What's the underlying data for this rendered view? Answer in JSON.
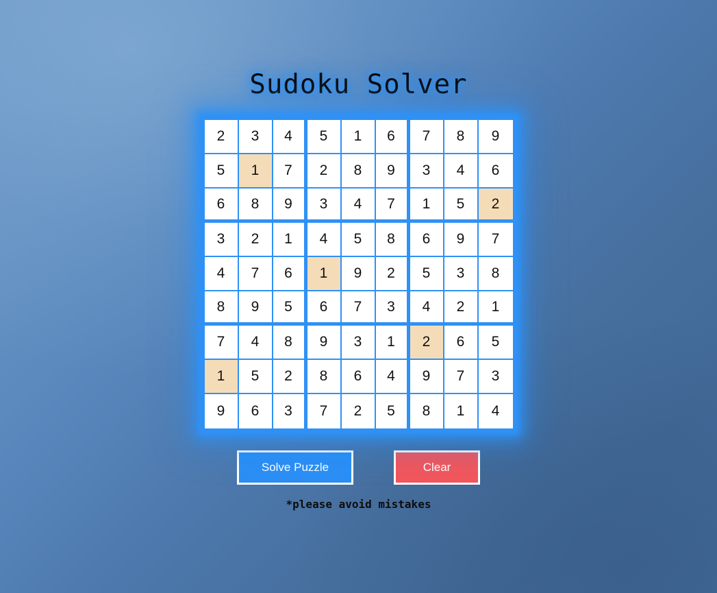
{
  "app": {
    "title": "Sudoku Solver",
    "footnote": "*please avoid mistakes"
  },
  "colors": {
    "grid_line": "#2f91f5",
    "cell_background": "#ffffff",
    "highlight_cell": "#f5dcb8",
    "solve_button": "#2b8ef5",
    "clear_button": "#f2565b",
    "button_border": "#ffffff",
    "title_glow": "#2f90f5",
    "background_light": "#7099c9",
    "background_dark": "#426a98"
  },
  "buttons": {
    "solve_label": "Solve Puzzle",
    "clear_label": "Clear"
  },
  "board": {
    "size": 9,
    "box_size": 3,
    "rows": [
      [
        "2",
        "3",
        "4",
        "5",
        "1",
        "6",
        "7",
        "8",
        "9"
      ],
      [
        "5",
        "1",
        "7",
        "2",
        "8",
        "9",
        "3",
        "4",
        "6"
      ],
      [
        "6",
        "8",
        "9",
        "3",
        "4",
        "7",
        "1",
        "5",
        "2"
      ],
      [
        "3",
        "2",
        "1",
        "4",
        "5",
        "8",
        "6",
        "9",
        "7"
      ],
      [
        "4",
        "7",
        "6",
        "1",
        "9",
        "2",
        "5",
        "3",
        "8"
      ],
      [
        "8",
        "9",
        "5",
        "6",
        "7",
        "3",
        "4",
        "2",
        "1"
      ],
      [
        "7",
        "4",
        "8",
        "9",
        "3",
        "1",
        "2",
        "6",
        "5"
      ],
      [
        "1",
        "5",
        "2",
        "8",
        "6",
        "4",
        "9",
        "7",
        "3"
      ],
      [
        "9",
        "6",
        "3",
        "7",
        "2",
        "5",
        "8",
        "1",
        "4"
      ]
    ],
    "highlighted": [
      {
        "row": 1,
        "col": 1,
        "value": "1"
      },
      {
        "row": 2,
        "col": 8,
        "value": "2"
      },
      {
        "row": 4,
        "col": 3,
        "value": "1"
      },
      {
        "row": 6,
        "col": 6,
        "value": "2"
      },
      {
        "row": 7,
        "col": 0,
        "value": "1"
      }
    ]
  }
}
